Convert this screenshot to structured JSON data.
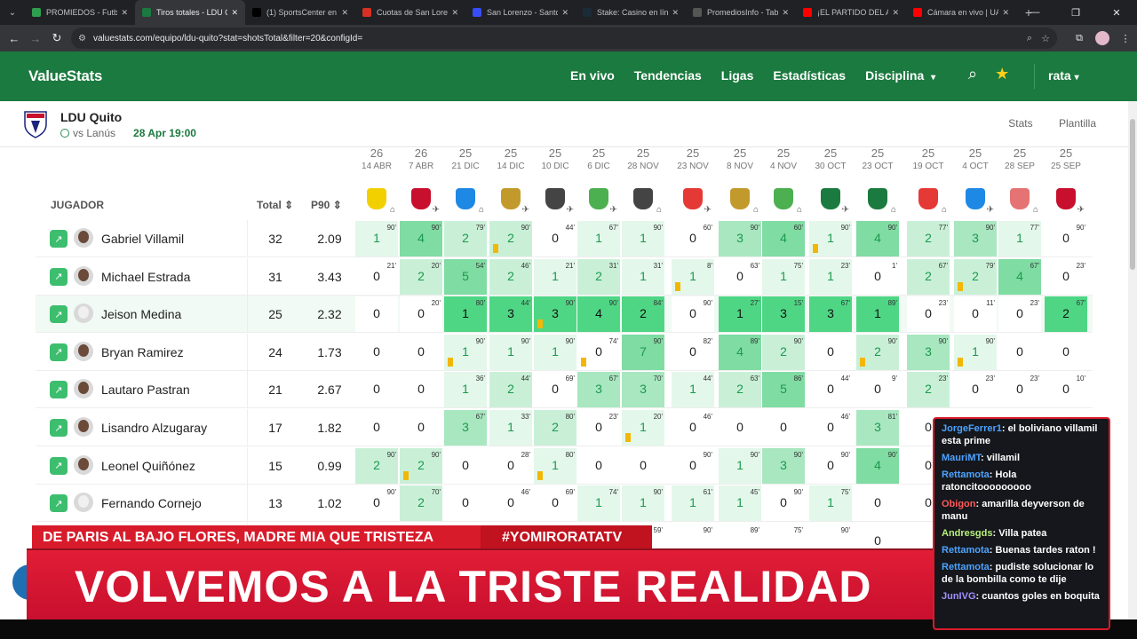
{
  "browser": {
    "tabs": [
      {
        "title": "PROMIEDOS - Futbol",
        "icon": "promiedos-icon",
        "color": "#2e9e4f",
        "active": false
      },
      {
        "title": "Tiros totales - LDU Qu",
        "icon": "valuestats-icon",
        "color": "#1b7a3f",
        "active": true
      },
      {
        "title": "(1) SportsCenter en X",
        "icon": "x-icon",
        "color": "#000000",
        "active": false
      },
      {
        "title": "Cuotas de San Lorenzo",
        "icon": "cuotas-icon",
        "color": "#d93025",
        "active": false
      },
      {
        "title": "San Lorenzo - Santos",
        "icon": "sofascore-icon",
        "color": "#374df5",
        "active": false
      },
      {
        "title": "Stake: Casino en línea",
        "icon": "stake-icon",
        "color": "#1a2c38",
        "active": false
      },
      {
        "title": "PromediosInfo - Tabla",
        "icon": "ball-icon",
        "color": "#555555",
        "active": false
      },
      {
        "title": "¡EL PARTIDO DEL AÑO",
        "icon": "youtube-icon",
        "color": "#ff0000",
        "active": false
      },
      {
        "title": "Cámara en vivo | UAG",
        "icon": "youtube-icon",
        "color": "#ff0000",
        "active": false
      }
    ],
    "url": "valuestats.com/equipo/ldu-quito?stat=shotsTotal&filter=20&configId="
  },
  "site": {
    "logo": "ValueStats",
    "menu": [
      "En vivo",
      "Tendencias",
      "Ligas",
      "Estadísticas",
      "Disciplina"
    ],
    "user": "rata"
  },
  "team": {
    "name": "LDU Quito",
    "next_opponent": "vs Lanús",
    "next_date": "28 Apr 19:00",
    "links": [
      "Stats",
      "Plantilla"
    ]
  },
  "table": {
    "headers": {
      "player": "JUGADOR",
      "total": "Total",
      "p90": "P90"
    },
    "matches": [
      {
        "day": "26",
        "date": "14 ABR",
        "loc": "home",
        "color": "#f2d000"
      },
      {
        "day": "26",
        "date": "7 ABR",
        "loc": "away",
        "color": "#c8102e"
      },
      {
        "day": "25",
        "date": "21 DIC",
        "loc": "home",
        "color": "#1e88e5"
      },
      {
        "day": "25",
        "date": "14 DIC",
        "loc": "away",
        "color": "#c29a2c"
      },
      {
        "day": "25",
        "date": "10 DIC",
        "loc": "away",
        "color": "#444444"
      },
      {
        "day": "25",
        "date": "6 DIC",
        "loc": "away",
        "color": "#4caf50"
      },
      {
        "day": "25",
        "date": "28 NOV",
        "loc": "home",
        "color": "#444444"
      },
      {
        "day": "25",
        "date": "23 NOV",
        "loc": "away",
        "color": "#e53935"
      },
      {
        "day": "25",
        "date": "8 NOV",
        "loc": "home",
        "color": "#c29a2c"
      },
      {
        "day": "25",
        "date": "4 NOV",
        "loc": "home",
        "color": "#4caf50"
      },
      {
        "day": "25",
        "date": "30 OCT",
        "loc": "away",
        "color": "#1b7a3f"
      },
      {
        "day": "25",
        "date": "23 OCT",
        "loc": "home",
        "color": "#1b7a3f"
      },
      {
        "day": "25",
        "date": "19 OCT",
        "loc": "home",
        "color": "#e53935"
      },
      {
        "day": "25",
        "date": "4 OCT",
        "loc": "away",
        "color": "#1e88e5"
      },
      {
        "day": "25",
        "date": "28 SEP",
        "loc": "home",
        "color": "#e57373"
      },
      {
        "day": "25",
        "date": "25 SEP",
        "loc": "away",
        "color": "#c8102e"
      }
    ],
    "players": [
      {
        "name": "Gabriel Villamil",
        "total": "32",
        "p90": "2.09",
        "avatar": "photo",
        "cells": [
          [
            "1",
            "90'",
            false
          ],
          [
            "4",
            "90'",
            false
          ],
          [
            "2",
            "79'",
            false
          ],
          [
            "2",
            "90'",
            true
          ],
          [
            "0",
            "44'",
            false
          ],
          [
            "1",
            "67'",
            false
          ],
          [
            "1",
            "90'",
            false
          ],
          [
            "0",
            "60'",
            false
          ],
          [
            "3",
            "90'",
            false
          ],
          [
            "4",
            "60'",
            false
          ],
          [
            "1",
            "90'",
            true
          ],
          [
            "4",
            "90'",
            false
          ],
          [
            "2",
            "77'",
            false
          ],
          [
            "3",
            "90'",
            false
          ],
          [
            "1",
            "77'",
            false
          ],
          [
            "0",
            "90'",
            false
          ]
        ]
      },
      {
        "name": "Michael Estrada",
        "total": "31",
        "p90": "3.43",
        "avatar": "photo",
        "cells": [
          [
            "0",
            "21'",
            false
          ],
          [
            "2",
            "20'",
            false
          ],
          [
            "5",
            "54'",
            false
          ],
          [
            "2",
            "46'",
            false
          ],
          [
            "1",
            "21'",
            false
          ],
          [
            "2",
            "31'",
            false
          ],
          [
            "1",
            "31'",
            false
          ],
          [
            "1",
            "8'",
            true
          ],
          [
            "0",
            "63'",
            false
          ],
          [
            "1",
            "75'",
            false
          ],
          [
            "1",
            "23'",
            false
          ],
          [
            "0",
            "1'",
            false
          ],
          [
            "2",
            "67'",
            false
          ],
          [
            "2",
            "79'",
            true
          ],
          [
            "4",
            "67'",
            false
          ],
          [
            "0",
            "23'",
            false
          ]
        ]
      },
      {
        "name": "Jeison Medina",
        "total": "25",
        "p90": "2.32",
        "avatar": "generic",
        "cells": [
          [
            "0",
            "",
            false
          ],
          [
            "0",
            "20'",
            false
          ],
          [
            "1",
            "80'",
            false
          ],
          [
            "3",
            "44'",
            false
          ],
          [
            "3",
            "90'",
            true
          ],
          [
            "4",
            "90'",
            false
          ],
          [
            "2",
            "84'",
            false
          ],
          [
            "0",
            "90'",
            false
          ],
          [
            "1",
            "27'",
            false
          ],
          [
            "3",
            "15'",
            false
          ],
          [
            "3",
            "67'",
            false
          ],
          [
            "1",
            "89'",
            false
          ],
          [
            "0",
            "23'",
            false
          ],
          [
            "0",
            "11'",
            false
          ],
          [
            "0",
            "23'",
            false
          ],
          [
            "2",
            "67'",
            false
          ]
        ]
      },
      {
        "name": "Bryan Ramirez",
        "total": "24",
        "p90": "1.73",
        "avatar": "photo",
        "cells": [
          [
            "0",
            "",
            false
          ],
          [
            "0",
            "",
            false
          ],
          [
            "1",
            "90'",
            true
          ],
          [
            "1",
            "90'",
            false
          ],
          [
            "1",
            "90'",
            false
          ],
          [
            "0",
            "74'",
            true
          ],
          [
            "7",
            "90'",
            false
          ],
          [
            "0",
            "82'",
            false
          ],
          [
            "4",
            "89'",
            false
          ],
          [
            "2",
            "90'",
            false
          ],
          [
            "0",
            "",
            false
          ],
          [
            "2",
            "90'",
            true
          ],
          [
            "3",
            "90'",
            false
          ],
          [
            "1",
            "90'",
            true
          ],
          [
            "0",
            "",
            false
          ],
          [
            "0",
            "",
            false
          ]
        ]
      },
      {
        "name": "Lautaro Pastran",
        "total": "21",
        "p90": "2.67",
        "avatar": "photo",
        "cells": [
          [
            "0",
            "",
            false
          ],
          [
            "0",
            "",
            false
          ],
          [
            "1",
            "36'",
            false
          ],
          [
            "2",
            "44'",
            false
          ],
          [
            "0",
            "69'",
            false
          ],
          [
            "3",
            "67'",
            false
          ],
          [
            "3",
            "70'",
            false
          ],
          [
            "1",
            "44'",
            false
          ],
          [
            "2",
            "63'",
            false
          ],
          [
            "5",
            "86'",
            false
          ],
          [
            "0",
            "44'",
            false
          ],
          [
            "0",
            "9'",
            false
          ],
          [
            "2",
            "23'",
            false
          ],
          [
            "0",
            "23'",
            false
          ],
          [
            "0",
            "23'",
            false
          ],
          [
            "0",
            "10'",
            false
          ]
        ]
      },
      {
        "name": "Lisandro Alzugaray",
        "total": "17",
        "p90": "1.82",
        "avatar": "photo",
        "cells": [
          [
            "0",
            "",
            false
          ],
          [
            "0",
            "",
            false
          ],
          [
            "3",
            "67'",
            false
          ],
          [
            "1",
            "33'",
            false
          ],
          [
            "2",
            "80'",
            false
          ],
          [
            "0",
            "23'",
            false
          ],
          [
            "1",
            "20'",
            true
          ],
          [
            "0",
            "46'",
            false
          ],
          [
            "0",
            "",
            false
          ],
          [
            "0",
            "",
            false
          ],
          [
            "0",
            "46'",
            false
          ],
          [
            "3",
            "81'",
            false
          ],
          [
            "0",
            "",
            false
          ],
          [
            "0",
            "",
            false
          ],
          [
            "0",
            "",
            false
          ],
          [
            "0",
            "",
            false
          ]
        ]
      },
      {
        "name": "Leonel Quiñónez",
        "total": "15",
        "p90": "0.99",
        "avatar": "photo",
        "cells": [
          [
            "2",
            "90'",
            false
          ],
          [
            "2",
            "90'",
            true
          ],
          [
            "0",
            "",
            false
          ],
          [
            "0",
            "28'",
            false
          ],
          [
            "1",
            "80'",
            true
          ],
          [
            "0",
            "",
            false
          ],
          [
            "0",
            "",
            false
          ],
          [
            "0",
            "90'",
            false
          ],
          [
            "1",
            "90'",
            false
          ],
          [
            "3",
            "90'",
            false
          ],
          [
            "0",
            "90'",
            false
          ],
          [
            "4",
            "90'",
            false
          ],
          [
            "0",
            "",
            false
          ],
          [
            "0",
            "",
            false
          ],
          [
            "0",
            "",
            false
          ],
          [
            "0",
            "",
            false
          ]
        ]
      },
      {
        "name": "Fernando Cornejo",
        "total": "13",
        "p90": "1.02",
        "avatar": "generic",
        "cells": [
          [
            "0",
            "90'",
            false
          ],
          [
            "2",
            "70'",
            false
          ],
          [
            "0",
            "",
            false
          ],
          [
            "0",
            "46'",
            false
          ],
          [
            "0",
            "69'",
            false
          ],
          [
            "1",
            "74'",
            false
          ],
          [
            "1",
            "90'",
            false
          ],
          [
            "1",
            "61'",
            false
          ],
          [
            "1",
            "45'",
            false
          ],
          [
            "0",
            "90'",
            false
          ],
          [
            "1",
            "75'",
            false
          ],
          [
            "0",
            "",
            false
          ],
          [
            "0",
            "",
            false
          ],
          [
            "0",
            "",
            false
          ],
          [
            "0",
            "",
            false
          ],
          [
            "0",
            "",
            false
          ]
        ]
      },
      {
        "name": "",
        "total": "",
        "p90": "",
        "avatar": "none",
        "cells": [
          [
            "",
            "",
            false
          ],
          [
            "",
            "",
            false
          ],
          [
            "",
            "",
            false
          ],
          [
            "",
            "",
            false
          ],
          [
            "",
            "",
            false
          ],
          [
            "",
            "",
            false
          ],
          [
            "",
            "59'",
            false
          ],
          [
            "",
            "90'",
            false
          ],
          [
            "",
            "89'",
            false
          ],
          [
            "",
            "75'",
            false
          ],
          [
            "",
            "90'",
            false
          ],
          [
            "0",
            "",
            false
          ],
          [
            "",
            "",
            false
          ],
          [
            "",
            "",
            false
          ],
          [
            "",
            "",
            false
          ],
          [
            "",
            "",
            false
          ]
        ]
      }
    ]
  },
  "overlay": {
    "ticker_left": "DE PARIS AL BAJO FLORES, MADRE MIA QUE TRISTEZA",
    "ticker_right": "#YOMIRORATATV",
    "headline": "VOLVEMOS A LA TRISTE REALIDAD",
    "chat": [
      {
        "user": "JorgeFerrer1",
        "msg": ": el boliviano villamil esta prime",
        "cls": "u"
      },
      {
        "user": "MauriMT",
        "msg": ": villamil",
        "cls": "u"
      },
      {
        "user": "Rettamota",
        "msg": ": Hola ratoncitooooooooo",
        "cls": "u"
      },
      {
        "user": "Obigon",
        "msg": ": amarilla deyverson de manu",
        "cls": "u2"
      },
      {
        "user": "Andresgds",
        "msg": ": Villa patea",
        "cls": "u3"
      },
      {
        "user": "Rettamota",
        "msg": ": Buenas tardes raton !",
        "cls": "u"
      },
      {
        "user": "Rettamota",
        "msg": ": pudiste solucionar lo de la bombilla como te dije",
        "cls": "u"
      },
      {
        "user": "JunIVG",
        "msg": ": cuantos goles en boquita",
        "cls": "u4"
      }
    ]
  }
}
